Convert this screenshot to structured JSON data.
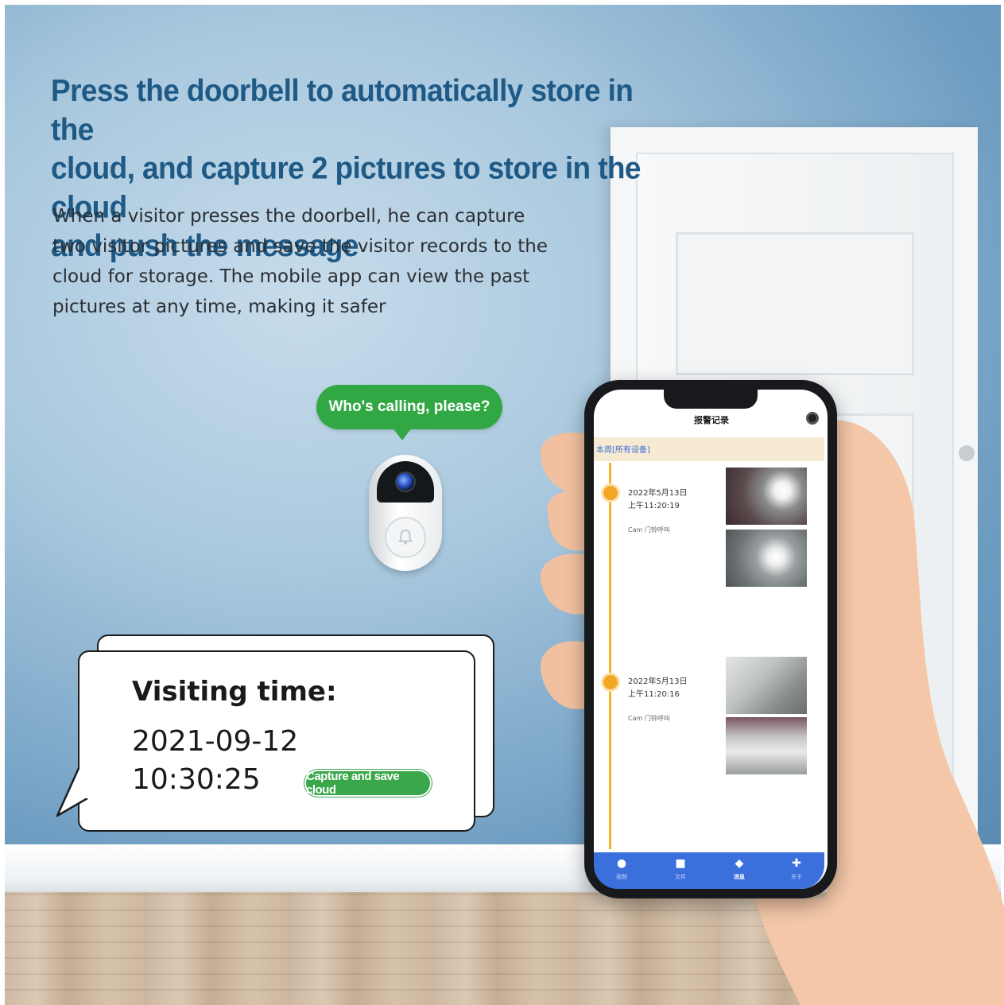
{
  "headline": {
    "line1": "Press the doorbell to automatically store in the",
    "line2": "cloud, and capture 2 pictures to store in the cloud",
    "line3": "and push the message"
  },
  "description": {
    "line1": "When a visitor presses the doorbell, he can capture",
    "line2": "two visitor pictures and save the visitor records to the",
    "line3": "cloud for storage. The mobile app can view the past",
    "line4": "pictures at any time, making it safer"
  },
  "bubble": {
    "text": "Who's calling, please?"
  },
  "visit_card": {
    "label": "Visiting time:",
    "date": "2021-09-12",
    "time": "10:30:25",
    "badge": "Capture and save cloud"
  },
  "app": {
    "title": "报警记录",
    "filter": "本周[所有设备]",
    "records": [
      {
        "date": "2022年5月13日",
        "time": "上午11:20:19",
        "source": "Cam   门铃呼叫"
      },
      {
        "date": "2022年5月13日",
        "time": "上午11:20:16",
        "source": "Cam   门铃呼叫"
      }
    ],
    "tabs": [
      {
        "label": "视频",
        "icon": "video-icon"
      },
      {
        "label": "文件",
        "icon": "folder-icon"
      },
      {
        "label": "消息",
        "icon": "message-icon"
      },
      {
        "label": "关于",
        "icon": "puzzle-icon"
      }
    ]
  },
  "colors": {
    "headline": "#1f5a86",
    "green": "#32a845",
    "tabbar": "#3a6fdc",
    "timeline": "#f2b233"
  }
}
